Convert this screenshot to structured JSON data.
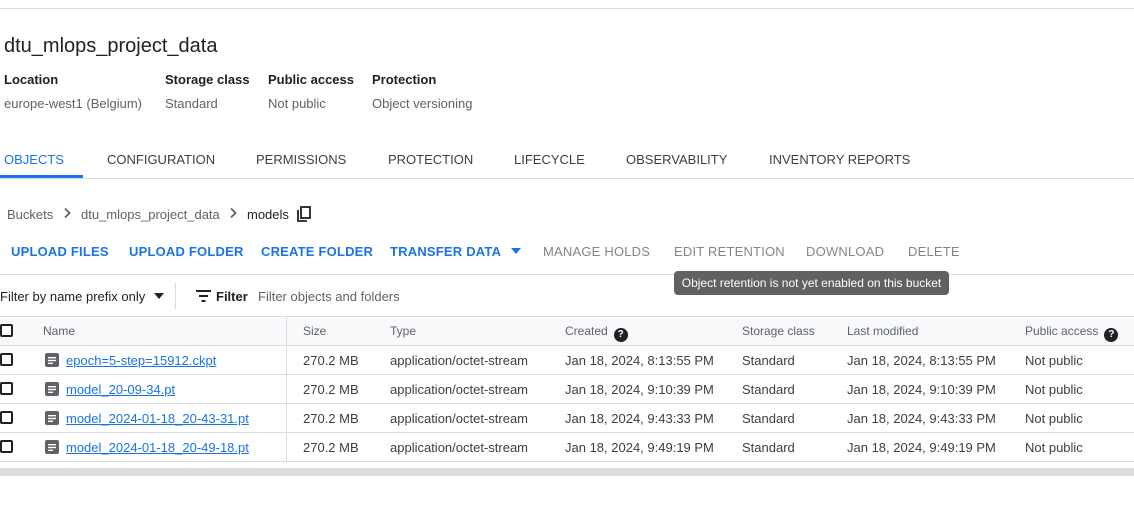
{
  "bucket": {
    "name": "dtu_mlops_project_data",
    "meta": [
      {
        "label": "Location",
        "value": "europe-west1 (Belgium)"
      },
      {
        "label": "Storage class",
        "value": "Standard"
      },
      {
        "label": "Public access",
        "value": "Not public"
      },
      {
        "label": "Protection",
        "value": "Object versioning"
      }
    ]
  },
  "tabs": [
    "OBJECTS",
    "CONFIGURATION",
    "PERMISSIONS",
    "PROTECTION",
    "LIFECYCLE",
    "OBSERVABILITY",
    "INVENTORY REPORTS"
  ],
  "active_tab": "OBJECTS",
  "breadcrumb": {
    "items": [
      "Buckets",
      "dtu_mlops_project_data"
    ],
    "current": "models",
    "copy_icon": "copy-icon"
  },
  "actions": {
    "upload_files": "UPLOAD FILES",
    "upload_folder": "UPLOAD FOLDER",
    "create_folder": "CREATE FOLDER",
    "transfer_data": "TRANSFER DATA",
    "manage_holds": "MANAGE HOLDS",
    "edit_retention": "EDIT RETENTION",
    "download": "DOWNLOAD",
    "delete": "DELETE"
  },
  "tooltip": "Object retention is not yet enabled on this bucket",
  "filter": {
    "prefix_select": "Filter by name prefix only",
    "label": "Filter",
    "placeholder": "Filter objects and folders",
    "value": ""
  },
  "table": {
    "columns": [
      "Name",
      "Size",
      "Type",
      "Created",
      "Storage class",
      "Last modified",
      "Public access"
    ],
    "rows": [
      {
        "name": "epoch=5-step=15912.ckpt",
        "size": "270.2 MB",
        "type": "application/octet-stream",
        "created": "Jan 18, 2024, 8:13:55 PM",
        "storage_class": "Standard",
        "last_modified": "Jan 18, 2024, 8:13:55 PM",
        "public_access": "Not public"
      },
      {
        "name": "model_20-09-34.pt",
        "size": "270.2 MB",
        "type": "application/octet-stream",
        "created": "Jan 18, 2024, 9:10:39 PM",
        "storage_class": "Standard",
        "last_modified": "Jan 18, 2024, 9:10:39 PM",
        "public_access": "Not public"
      },
      {
        "name": "model_2024-01-18_20-43-31.pt",
        "size": "270.2 MB",
        "type": "application/octet-stream",
        "created": "Jan 18, 2024, 9:43:33 PM",
        "storage_class": "Standard",
        "last_modified": "Jan 18, 2024, 9:43:33 PM",
        "public_access": "Not public"
      },
      {
        "name": "model_2024-01-18_20-49-18.pt",
        "size": "270.2 MB",
        "type": "application/octet-stream",
        "created": "Jan 18, 2024, 9:49:19 PM",
        "storage_class": "Standard",
        "last_modified": "Jan 18, 2024, 9:49:19 PM",
        "public_access": "Not public"
      }
    ]
  },
  "colors": {
    "accent": "#1a73e8",
    "text": "#202124",
    "muted": "#5f6368",
    "border": "#dadce0",
    "tooltip_bg": "#616161"
  }
}
